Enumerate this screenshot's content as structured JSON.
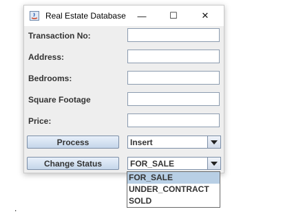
{
  "window": {
    "title": "Real Estate Database",
    "controls": {
      "minimize": "—",
      "maximize": "☐",
      "close": "✕"
    }
  },
  "form": {
    "fields": [
      {
        "label": "Transaction No:",
        "value": ""
      },
      {
        "label": "Address:",
        "value": ""
      },
      {
        "label": "Bedrooms:",
        "value": ""
      },
      {
        "label": "Square Footage",
        "value": ""
      },
      {
        "label": "Price:",
        "value": ""
      }
    ],
    "process_button": "Process",
    "action_combo": {
      "selected": "Insert"
    },
    "change_status_button": "Change Status",
    "status_combo": {
      "selected": "FOR_SALE",
      "options": [
        "FOR_SALE",
        "UNDER_CONTRACT",
        "SOLD"
      ],
      "highlighted": "FOR_SALE"
    }
  },
  "background_text": "."
}
